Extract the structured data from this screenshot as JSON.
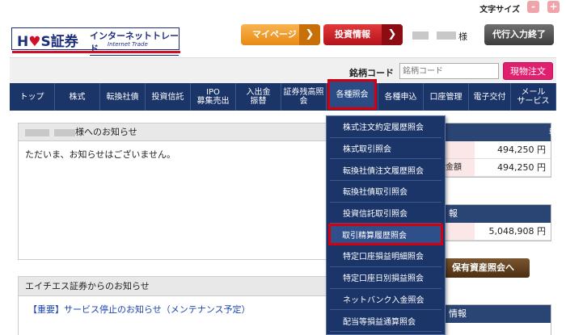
{
  "font_size_bar": {
    "label": "文字サイズ",
    "minus": "-",
    "plus": "+"
  },
  "header": {
    "logo": {
      "brand_h": "H",
      "brand_heart": "♥",
      "brand_s": "S証券",
      "sub": "インターネットトレード",
      "en": "Internet Trade"
    },
    "mypage_label": "マイページ",
    "invest_label": "投資情報",
    "arrow": "❯",
    "user_suffix": "様",
    "proxy_end_label": "代行入力終了"
  },
  "search": {
    "label": "銘柄コード",
    "placeholder": "銘柄コード",
    "order_label": "現物注文"
  },
  "nav": [
    {
      "label": "トップ",
      "width": 56
    },
    {
      "label": "株式",
      "width": 56
    },
    {
      "label": "転換社債",
      "width": 56
    },
    {
      "label": "投資信託",
      "width": 56
    },
    {
      "label": "IPO\n募集売出",
      "width": 56
    },
    {
      "label": "入出金\n振替",
      "width": 56
    },
    {
      "label": "証券残高照\n会",
      "width": 56
    },
    {
      "label": "各種照会",
      "width": 64
    },
    {
      "label": "各種申込",
      "width": 56
    },
    {
      "label": "口座管理",
      "width": 56
    },
    {
      "label": "電子交付",
      "width": 52
    },
    {
      "label": "メール\nサービス",
      "width": 56
    }
  ],
  "notice": {
    "heading_suffix": "様へのお知らせ",
    "body": "ただいま、お知らせはございません。"
  },
  "hs_notice": {
    "heading": "エイチエス証券からのお知らせ",
    "link": "【重要】サービス停止のお知らせ（メンテナンス予定）"
  },
  "right_panel_1": {
    "heading": "報",
    "rows": [
      {
        "label": "",
        "value": "494,250 円"
      },
      {
        "label": "金額",
        "value": "494,250 円"
      }
    ]
  },
  "right_panel_2": {
    "heading": "報",
    "rows": [
      {
        "label": "",
        "value": "5,048,908 円"
      }
    ]
  },
  "assets_button": "保有資産照会へ",
  "right_panel_3": {
    "heading": "情報"
  },
  "dropdown": {
    "items": [
      "株式注文約定履歴照会",
      "株式取引照会",
      "転換社債注文履歴照会",
      "転換社債取引照会",
      "投資信託取引照会",
      "取引精算履歴照会",
      "特定口座損益明細照会",
      "特定口座日別損益照会",
      "ネットバンク入金照会",
      "配当等損益通算照会"
    ],
    "selected_index": 5
  },
  "colors": {
    "nav_bg": "#1b3569",
    "accent_red": "#d40010",
    "order_pink": "#e0206e"
  }
}
